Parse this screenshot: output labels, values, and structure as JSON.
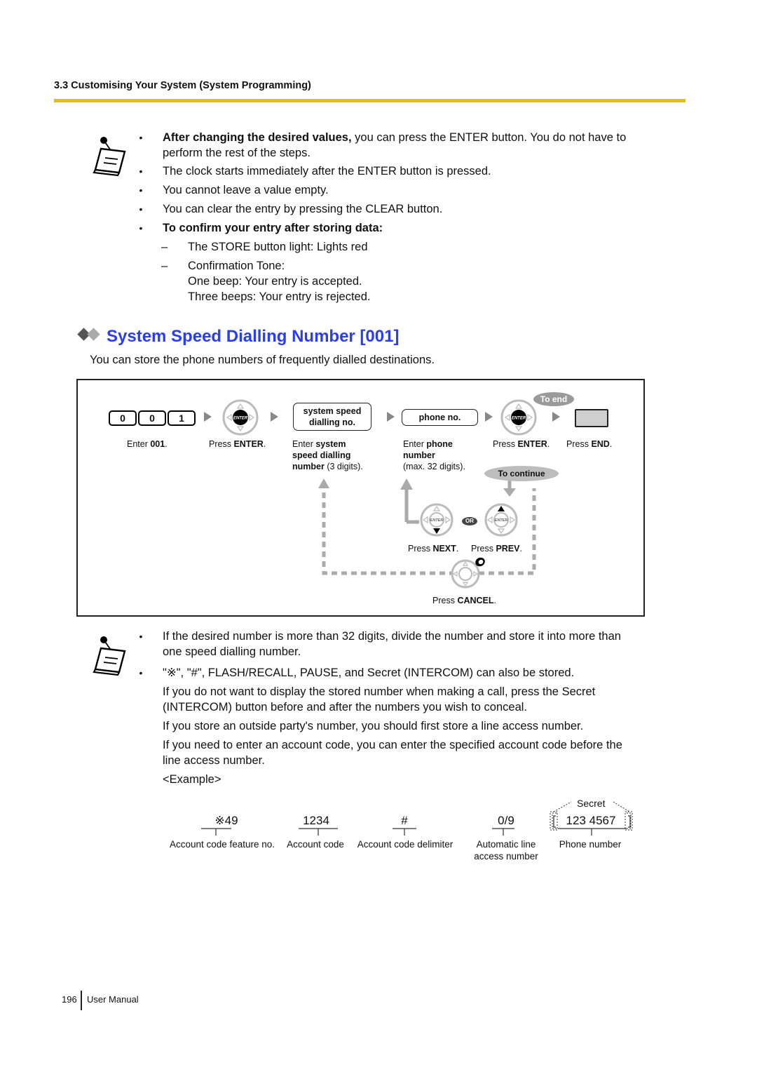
{
  "header": {
    "section": "3.3 Customising Your System (System Programming)",
    "accent_color": "#e0c400"
  },
  "note1": {
    "icon": "note-pad-icon",
    "items": [
      {
        "bold": "After changing the desired values,",
        "text": " you can press the ENTER button. You do not have to",
        "cont": "perform the rest of the steps."
      },
      {
        "text": "The clock starts immediately after the ENTER button is pressed."
      },
      {
        "text": "You cannot leave a value empty."
      },
      {
        "text": "You can clear the entry by pressing the CLEAR button."
      },
      {
        "bold": "To confirm your entry after storing data:"
      }
    ],
    "sub_items": [
      {
        "text": "The STORE button light: Lights red"
      },
      {
        "text": "Confirmation Tone:",
        "line2": "One beep: Your entry is accepted.",
        "line3": "Three beeps: Your entry is rejected."
      }
    ]
  },
  "section": {
    "title": "System Speed Dialling Number [001]",
    "title_color": "#2a3df2",
    "description": "You can store the phone numbers of frequently dialled destinations."
  },
  "flow": {
    "keys": [
      "0",
      "0",
      "1"
    ],
    "step1": {
      "pre": "Enter ",
      "bold": "001",
      "post": "."
    },
    "enter_key_label": "ENTER",
    "step2": {
      "pre": "Press ",
      "bold": "ENTER",
      "post": "."
    },
    "box1": {
      "line1": "system speed",
      "line2": "dialling no."
    },
    "step3": {
      "pre": "Enter ",
      "bold1": "system",
      "bold2": "speed dialling",
      "bold3": "number",
      "post": " (3 digits)."
    },
    "box2": "phone no.",
    "step4": {
      "pre": "Enter ",
      "bold1": "phone",
      "bold2": "number",
      "post": "(max. 32 digits)."
    },
    "to_end": "To end",
    "step5": {
      "pre": "Press ",
      "bold": "ENTER",
      "post": "."
    },
    "step6": {
      "pre": "Press ",
      "bold": "END",
      "post": "."
    },
    "to_continue": "To continue",
    "or_label": "OR",
    "next": {
      "pre": "Press ",
      "bold": "NEXT",
      "post": "."
    },
    "prev": {
      "pre": "Press ",
      "bold": "PREV",
      "post": "."
    },
    "cancel": {
      "pre": "Press ",
      "bold": "CANCEL",
      "post": "."
    }
  },
  "note2": {
    "icon": "note-pad-icon",
    "items": [
      {
        "text": "If the desired number is more than 32 digits, divide the number and store it into more than",
        "cont": "one speed dialling number."
      },
      {
        "text": "\"※\", \"#\", FLASH/RECALL, PAUSE, and Secret (INTERCOM) can also be stored."
      }
    ],
    "paragraphs": [
      {
        "l1": "If you do not want to display the stored number when making a call, press the Secret",
        "l2": "(INTERCOM) button before and after the numbers you wish to conceal."
      },
      {
        "l1": "If you store an outside party's number, you should first store a line access number."
      },
      {
        "l1": "If you need to enter an account code, you can enter the specified account code before the",
        "l2": "line access number."
      },
      {
        "l1": "<Example>"
      }
    ]
  },
  "example": {
    "secret_label": "Secret",
    "parts": [
      {
        "value": "※49",
        "label": "Account code feature no."
      },
      {
        "value": "1234",
        "label": "Account code"
      },
      {
        "value": "#",
        "label": "Account code delimiter"
      },
      {
        "value": "0/9",
        "label": "Automatic line",
        "label2": "access number"
      },
      {
        "value": "123  4567",
        "label": "Phone number"
      }
    ]
  },
  "footer": {
    "page": "196",
    "title": "User Manual"
  }
}
